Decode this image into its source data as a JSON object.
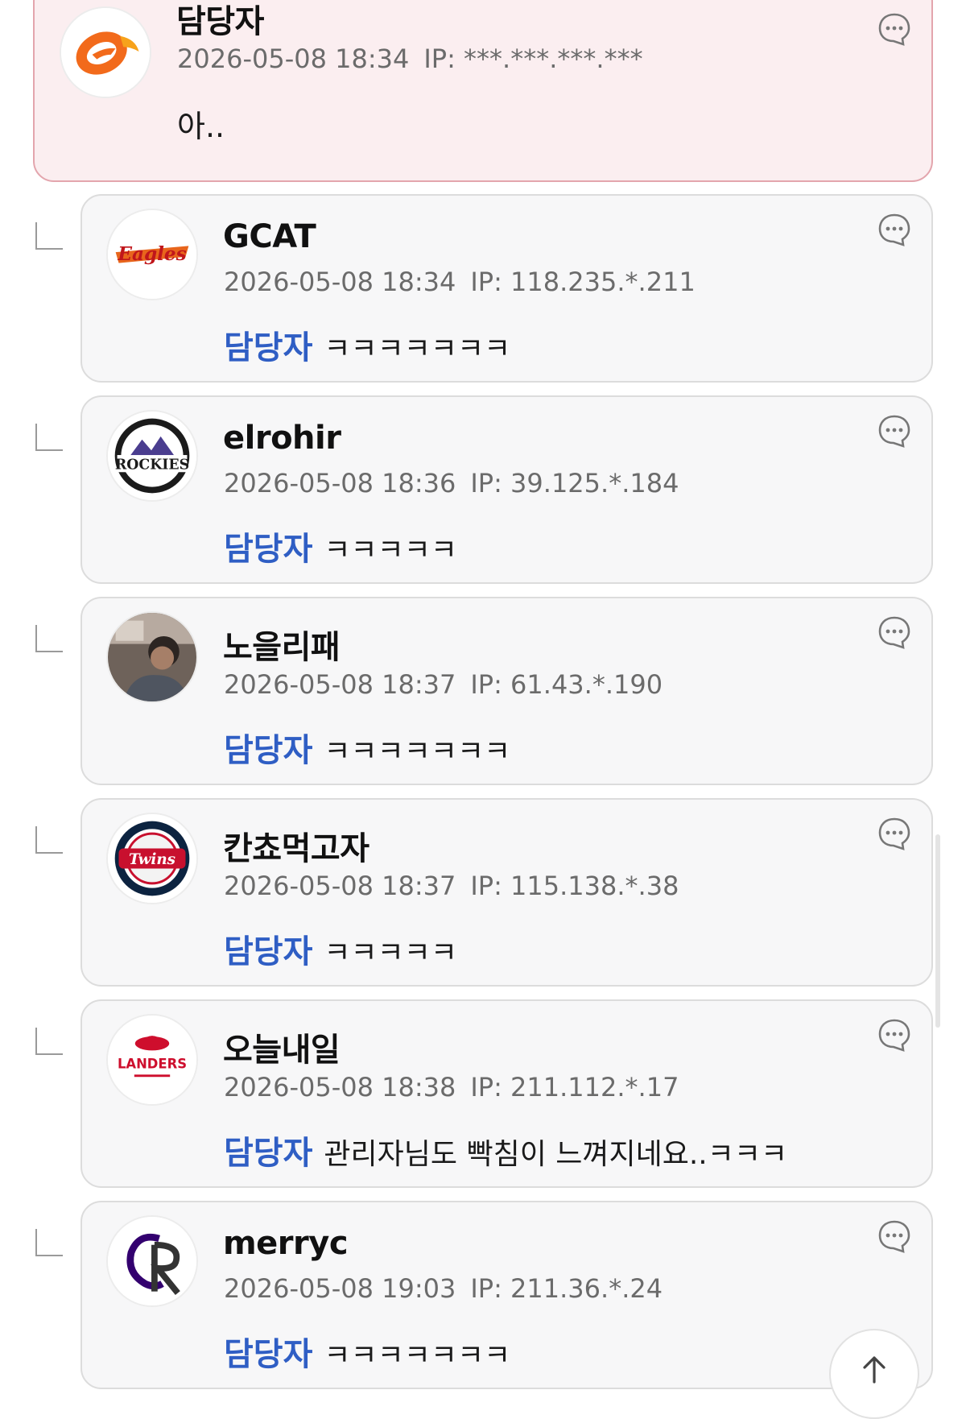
{
  "parent_comment": {
    "nickname": "담당자",
    "date": "2026-05-08 18:34",
    "ip": "IP: ***.***.***.***",
    "text": "아..",
    "avatar_icon": "hanwha-logo-icon"
  },
  "replies": [
    {
      "nickname": "GCAT",
      "date": "2026-05-08 18:34",
      "ip": "IP: 118.235.*.211",
      "mention": "담당자",
      "text": "ㅋㅋㅋㅋㅋㅋㅋ",
      "avatar_icon": "hanwha-eagles-logo-icon",
      "avatar_text": "Eagles"
    },
    {
      "nickname": "elrohir",
      "date": "2026-05-08 18:36",
      "ip": "IP: 39.125.*.184",
      "mention": "담당자",
      "text": "ㅋㅋㅋㅋㅋ",
      "avatar_icon": "colorado-rockies-logo-icon",
      "avatar_text": "ROCKIES"
    },
    {
      "nickname": "노을리패",
      "date": "2026-05-08 18:37",
      "ip": "IP: 61.43.*.190",
      "mention": "담당자",
      "text": "ㅋㅋㅋㅋㅋㅋㅋ",
      "avatar_icon": "user-photo-icon"
    },
    {
      "nickname": "칸쵸먹고자",
      "date": "2026-05-08 18:37",
      "ip": "IP: 115.138.*.38",
      "mention": "담당자",
      "text": "ㅋㅋㅋㅋㅋ",
      "avatar_icon": "minnesota-twins-logo-icon",
      "avatar_text": "Twins"
    },
    {
      "nickname": "오늘내일",
      "date": "2026-05-08 18:38",
      "ip": "IP: 211.112.*.17",
      "mention": "담당자",
      "text": "관리자님도 빡침이 느껴지네요..ㅋㅋㅋ",
      "avatar_icon": "ssg-landers-logo-icon",
      "avatar_text": "LANDERS"
    },
    {
      "nickname": "merryc",
      "date": "2026-05-08 19:03",
      "ip": "IP: 211.36.*.24",
      "mention": "담당자",
      "text": "ㅋㅋㅋㅋㅋㅋㅋ",
      "avatar_icon": "colorado-rockies-cr-logo-icon"
    }
  ],
  "colors": {
    "mention": "#2f5ec4",
    "parent_highlight_bg": "#fbeef0",
    "parent_highlight_border": "#e3a5ad",
    "card_bg": "#f7f7f8"
  },
  "icons": {
    "more": "comment-more-icon",
    "reply": "reply-arrow-icon",
    "scroll_top": "arrow-up-icon"
  }
}
